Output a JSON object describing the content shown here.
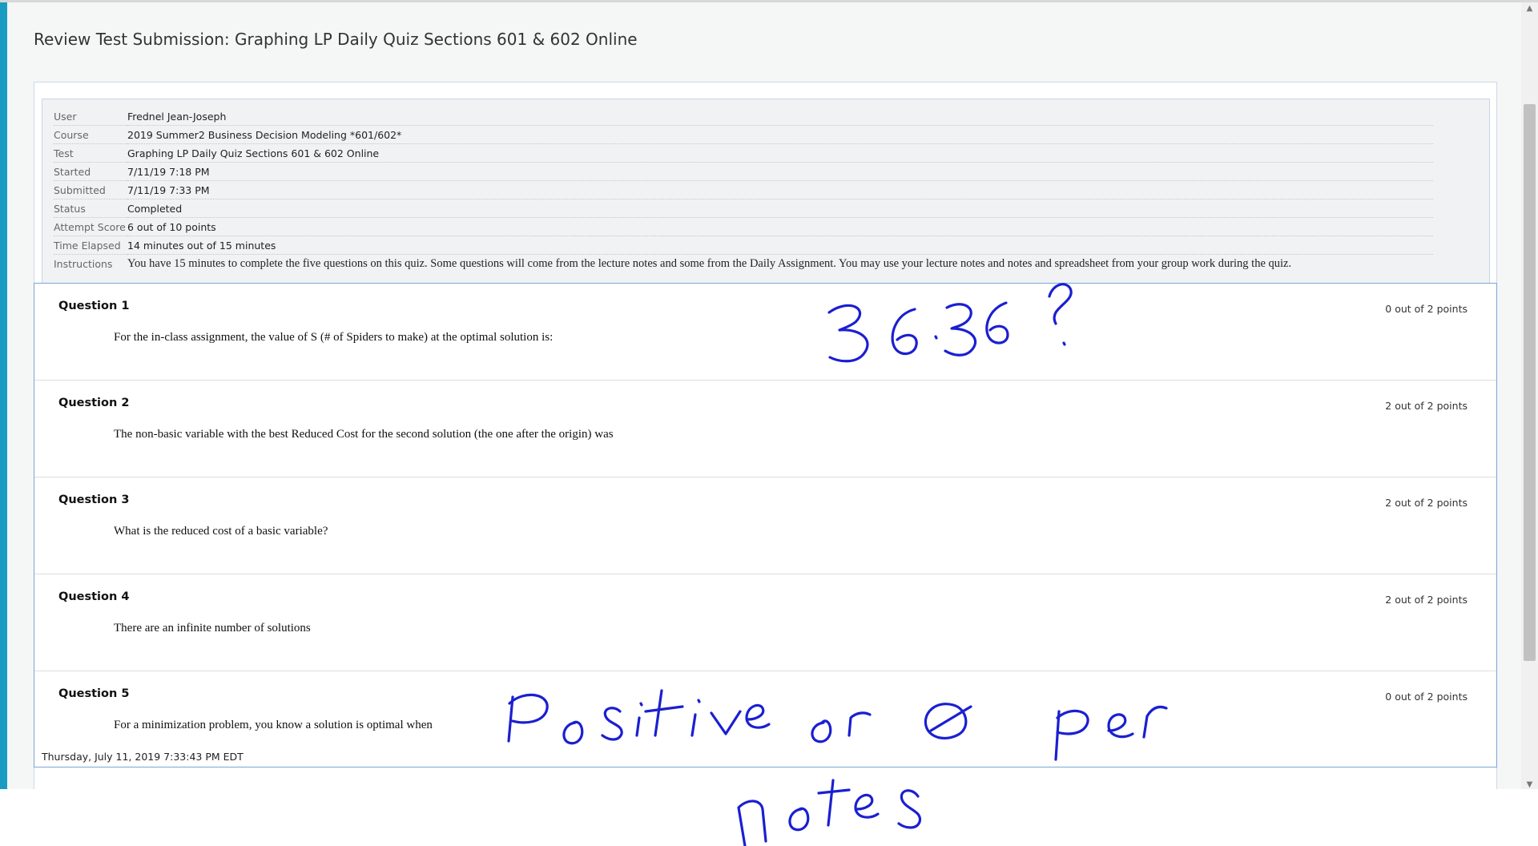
{
  "page": {
    "title": "Review Test Submission: Graphing LP Daily Quiz Sections 601 & 602 Online"
  },
  "info": [
    {
      "label": "User",
      "value": "Frednel Jean-Joseph"
    },
    {
      "label": "Course",
      "value": "2019 Summer2 Business Decision Modeling *601/602*"
    },
    {
      "label": "Test",
      "value": "Graphing LP Daily Quiz Sections 601 & 602 Online"
    },
    {
      "label": "Started",
      "value": "7/11/19 7:18 PM"
    },
    {
      "label": "Submitted",
      "value": "7/11/19 7:33 PM"
    },
    {
      "label": "Status",
      "value": "Completed"
    },
    {
      "label": "Attempt Score",
      "value": "6 out of 10 points"
    },
    {
      "label": "Time Elapsed",
      "value": "14 minutes out of 15 minutes"
    },
    {
      "label": "Instructions",
      "value": "You have 15 minutes to complete the five questions on this quiz.  Some questions will come from the lecture notes and some from the Daily Assignment.  You may use your lecture notes and notes and spreadsheet from your group work during the quiz."
    }
  ],
  "questions": [
    {
      "title": "Question 1",
      "points": "0 out of 2 points",
      "text": "For the in-class assignment, the value of S (# of Spiders to make) at the optimal solution is:"
    },
    {
      "title": "Question 2",
      "points": "2 out of 2 points",
      "text": "The non-basic variable with the best Reduced Cost for the second solution (the one after the origin) was"
    },
    {
      "title": "Question 3",
      "points": "2 out of 2 points",
      "text": "What is the reduced cost of a basic variable?"
    },
    {
      "title": "Question 4",
      "points": "2 out of 2 points",
      "text": "There are an infinite number of solutions"
    },
    {
      "title": "Question 5",
      "points": "0 out of 2 points",
      "text": "For a minimization problem, you know a solution is optimal when"
    }
  ],
  "footer": {
    "timestamp": "Thursday, July 11, 2019 7:33:43 PM EDT"
  },
  "annotations": {
    "note1": "36.36 ?",
    "note2": "Positive or 0 per notes"
  },
  "colors": {
    "accent": "#1a9cc2",
    "ink": "#1b1fd1"
  }
}
